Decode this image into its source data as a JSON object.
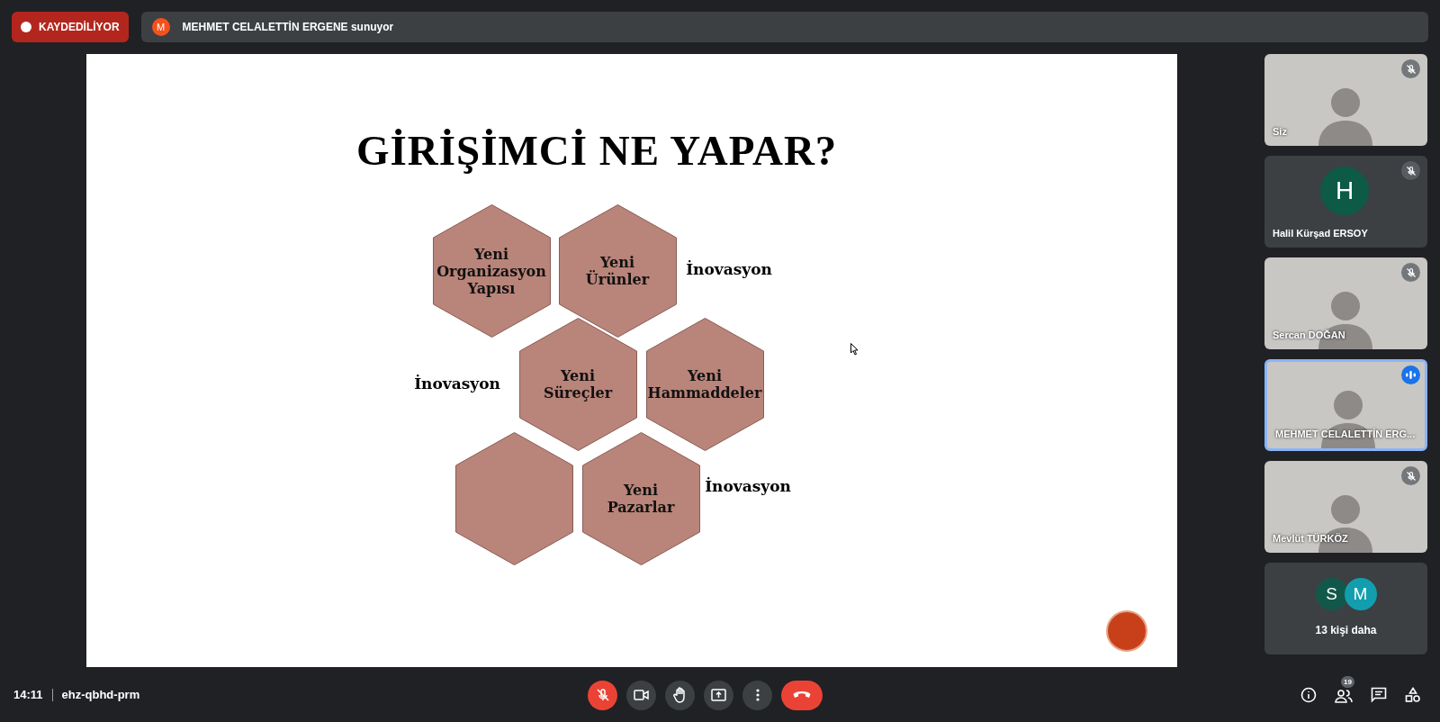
{
  "recording": {
    "label": "KAYDEDİLİYOR"
  },
  "presenter": {
    "initial": "M",
    "text": "MEHMET CELALETTİN ERGENE sunuyor"
  },
  "slide": {
    "title": "GİRİŞİMCİ NE YAPAR?",
    "hexagons": [
      {
        "kind": "labeled",
        "lines": [
          "Yeni",
          "Organizasyon",
          "Yapısı"
        ]
      },
      {
        "kind": "labeled",
        "lines": [
          "Yeni",
          "Ürünler"
        ]
      },
      {
        "kind": "labeled",
        "lines": [
          "Yeni",
          "Süreçler"
        ]
      },
      {
        "kind": "labeled",
        "lines": [
          "Yeni",
          "Hammaddeler"
        ]
      },
      {
        "kind": "blank"
      },
      {
        "kind": "labeled",
        "lines": [
          "Yeni",
          "Pazarlar"
        ]
      }
    ],
    "labels": [
      "İnovasyon",
      "İnovasyon",
      "İnovasyon"
    ]
  },
  "participants": [
    {
      "kind": "video",
      "name": "Siz",
      "muted": true,
      "speaking": false
    },
    {
      "kind": "avatar",
      "name": "Halil Kürşad ERSOY",
      "initial": "H",
      "color": "#0d5b47",
      "muted": true,
      "speaking": false
    },
    {
      "kind": "video",
      "name": "Sercan DOĞAN",
      "muted": true,
      "speaking": false
    },
    {
      "kind": "video",
      "name": "MEHMET CELALETTİN ERG...",
      "muted": false,
      "speaking": true
    },
    {
      "kind": "video",
      "name": "Mevlüt TÜRKÖZ",
      "muted": true,
      "speaking": false
    },
    {
      "kind": "more",
      "avatars": [
        {
          "initial": "S",
          "color": "#12584a"
        },
        {
          "initial": "M",
          "color": "#129eaf"
        }
      ],
      "text": "13 kişi daha"
    }
  ],
  "bottom_bar": {
    "time": "14:11",
    "meeting_code": "ehz-qbhd-prm",
    "mic_muted": true,
    "participant_count": "19"
  }
}
